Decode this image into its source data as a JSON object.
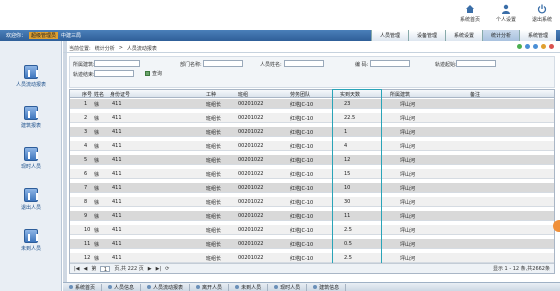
{
  "top": {
    "icons": [
      {
        "label": "系统首页",
        "icon": "home-icon"
      },
      {
        "label": "个人设置",
        "icon": "user-icon"
      },
      {
        "label": "退出系统",
        "icon": "power-icon"
      }
    ]
  },
  "titlebar": {
    "welcome": "欢迎你：",
    "user": "超级管理员",
    "company": "中建三局"
  },
  "tabs": [
    "人员管理",
    "设备管理",
    "系统设置",
    "统计分析",
    "系统管理"
  ],
  "active_tab": 3,
  "sidebar": [
    {
      "label": "人员流动报表"
    },
    {
      "label": "建筑报表"
    },
    {
      "label": "现时人员"
    },
    {
      "label": "退出人员"
    },
    {
      "label": "未到人员"
    }
  ],
  "breadcrumb": {
    "prefix": "当前位置:",
    "items": [
      "统计分析",
      ">",
      "人员流动报表"
    ]
  },
  "filter": {
    "labels": {
      "building": "所属建筑:",
      "dept": "部门名称:",
      "name": "人员姓名:",
      "id": "编 码:",
      "start": "轨迹起始:",
      "end": "轨迹结束:"
    },
    "search": "查询"
  },
  "table": {
    "headers": [
      "序号",
      "姓名",
      "身份证号",
      "工种",
      "班组",
      "劳务团队",
      "实到天数",
      "所属建筑",
      "备注"
    ],
    "rows": [
      {
        "no": "1",
        "name": "徐",
        "id": "411",
        "job": "班组长",
        "team": "00201022",
        "labor": "红塔JC-10",
        "days": "23",
        "bldg": "坪山河"
      },
      {
        "no": "2",
        "name": "徐",
        "id": "411",
        "job": "班组长",
        "team": "00201022",
        "labor": "红塔JC-10",
        "days": "22.5",
        "bldg": "坪山河"
      },
      {
        "no": "3",
        "name": "徐",
        "id": "411",
        "job": "班组长",
        "team": "00201022",
        "labor": "红塔JC-10",
        "days": "1",
        "bldg": "坪山河"
      },
      {
        "no": "4",
        "name": "徐",
        "id": "411",
        "job": "班组长",
        "team": "00201022",
        "labor": "红塔JC-10",
        "days": "4",
        "bldg": "坪山河"
      },
      {
        "no": "5",
        "name": "徐",
        "id": "411",
        "job": "班组长",
        "team": "00201022",
        "labor": "红塔JC-10",
        "days": "12",
        "bldg": "坪山河"
      },
      {
        "no": "6",
        "name": "徐",
        "id": "411",
        "job": "班组长",
        "team": "00201022",
        "labor": "红塔JC-10",
        "days": "15",
        "bldg": "坪山河"
      },
      {
        "no": "7",
        "name": "徐",
        "id": "411",
        "job": "班组长",
        "team": "00201022",
        "labor": "红塔JC-10",
        "days": "10",
        "bldg": "坪山河"
      },
      {
        "no": "8",
        "name": "徐",
        "id": "411",
        "job": "班组长",
        "team": "00201022",
        "labor": "红塔JC-10",
        "days": "30",
        "bldg": "坪山河"
      },
      {
        "no": "9",
        "name": "徐",
        "id": "411",
        "job": "班组长",
        "team": "00201022",
        "labor": "红塔JC-10",
        "days": "11",
        "bldg": "坪山河"
      },
      {
        "no": "10",
        "name": "徐",
        "id": "411",
        "job": "班组长",
        "team": "00201022",
        "labor": "红塔JC-10",
        "days": "2.5",
        "bldg": "坪山河"
      },
      {
        "no": "11",
        "name": "徐",
        "id": "411",
        "job": "班组长",
        "team": "00201022",
        "labor": "红塔JC-10",
        "days": "0.5",
        "bldg": "坪山河"
      },
      {
        "no": "12",
        "name": "徐",
        "id": "411",
        "job": "班组长",
        "team": "00201022",
        "labor": "红塔JC-10",
        "days": "2.5",
        "bldg": "坪山河"
      }
    ]
  },
  "pager": {
    "page_label": "第",
    "page": "1",
    "total_pages": "页,共 222 页",
    "info": "显示 1 - 12 条,共2662条"
  },
  "bottom_tabs": [
    "系统首页",
    "人员信息",
    "人员流动报表",
    "离开人员",
    "未到人员",
    "现时人员",
    "建筑信息"
  ],
  "colors": {
    "accent": "#2f5f98",
    "highlight": "#2aa4b8"
  }
}
